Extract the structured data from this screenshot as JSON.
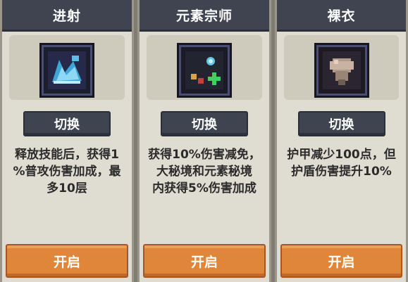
{
  "cards": [
    {
      "title": "进射",
      "icon": "ranged-burst-icon",
      "switch_label": "切换",
      "description": "释放技能后，获得1\n%普攻伤害加成，最\n多10层",
      "open_label": "开启"
    },
    {
      "title": "元素宗师",
      "icon": "elemental-master-icon",
      "switch_label": "切换",
      "description": "获得10%伤害减免，\n大秘境和元素秘境\n内获得5%伤害加成",
      "open_label": "开启"
    },
    {
      "title": "裸衣",
      "icon": "bare-armor-icon",
      "switch_label": "切换",
      "description": "护甲减少100点，但\n护盾伤害提升10%",
      "open_label": "开启"
    }
  ],
  "colors": {
    "header_bg": "#3f4450",
    "card_bg": "#dfddd1",
    "open_button": "#e0863a"
  }
}
